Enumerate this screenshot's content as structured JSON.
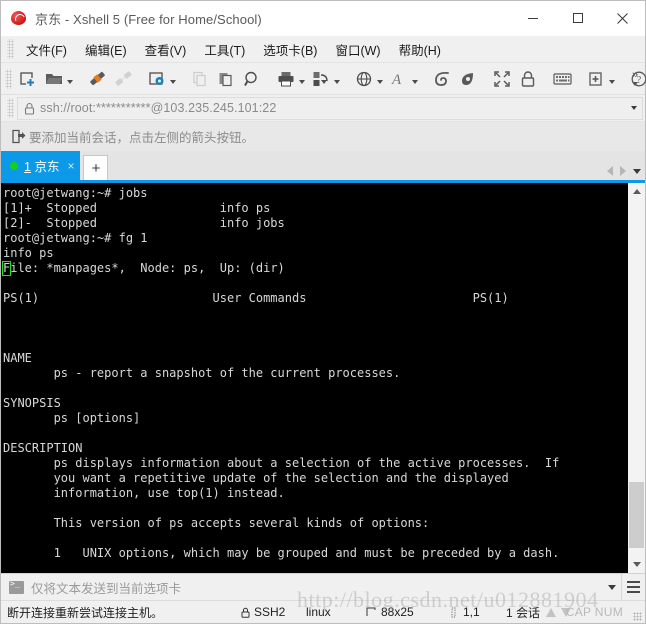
{
  "window": {
    "title": "京东 - Xshell 5 (Free for Home/School)",
    "app_icon": "xshell-logo-icon",
    "minimize_label": "—",
    "maximize_label": "□",
    "close_label": "✕"
  },
  "menubar": {
    "items": [
      {
        "label": "文件(F)",
        "name": "menu-file"
      },
      {
        "label": "编辑(E)",
        "name": "menu-edit"
      },
      {
        "label": "查看(V)",
        "name": "menu-view"
      },
      {
        "label": "工具(T)",
        "name": "menu-tools"
      },
      {
        "label": "选项卡(B)",
        "name": "menu-tabs"
      },
      {
        "label": "窗口(W)",
        "name": "menu-window"
      },
      {
        "label": "帮助(H)",
        "name": "menu-help"
      }
    ]
  },
  "toolbar": {
    "overflow_label": "»",
    "icons": [
      "new-session-icon",
      "open-folder-icon",
      "connect-icon",
      "disconnect-icon",
      "session-properties-icon",
      "copy-icon",
      "paste-icon",
      "find-icon",
      "print-icon",
      "transfer-icon",
      "globe-icon",
      "font-icon",
      "xftp-icon",
      "xagent-icon",
      "fullscreen-icon",
      "lock-icon",
      "keyboard-icon",
      "add-folder-icon",
      "help-icon"
    ]
  },
  "address_bar": {
    "lock_icon": "lock-icon",
    "value": "ssh://root:***********@103.235.245.101:22",
    "placeholder": "ssh://",
    "dropdown_icon": "chevron-down-icon"
  },
  "hint_bar": {
    "icon": "add-to-session-icon",
    "text": "要添加当前会话，点击左侧的箭头按钮。"
  },
  "tabs": {
    "active": {
      "index": "1",
      "title": "京东",
      "status_dot_color": "#15d015",
      "close_label": "×"
    },
    "new_tab_label": "+",
    "nav_prev_icon": "chevron-left-icon",
    "nav_next_icon": "chevron-right-icon",
    "nav_menu_icon": "chevron-down-icon"
  },
  "terminal": {
    "cursor_char": "F",
    "lines_before_cursor": [
      "root@jetwang:~# jobs",
      "[1]+  Stopped                 info ps",
      "[2]-  Stopped                 info jobs",
      "root@jetwang:~# fg 1",
      "info ps"
    ],
    "cursor_line_rest": "ile: *manpages*,  Node: ps,  Up: (dir)",
    "lines_after_cursor": [
      "",
      "PS(1)                        User Commands                       PS(1)",
      "",
      "",
      "",
      "NAME",
      "       ps - report a snapshot of the current processes.",
      "",
      "SYNOPSIS",
      "       ps [options]",
      "",
      "DESCRIPTION",
      "       ps displays information about a selection of the active processes.  If",
      "       you want a repetitive update of the selection and the displayed",
      "       information, use top(1) instead.",
      "",
      "       This version of ps accepts several kinds of options:",
      "",
      "       1   UNIX options, which may be grouped and must be preceded by a dash.",
      ""
    ],
    "scrollbar": {
      "up_icon": "chevron-up-icon",
      "down_icon": "chevron-down-icon"
    }
  },
  "send_bar": {
    "icon": "terminal-prompt-icon",
    "text": "仅将文本发送到当前选项卡",
    "dropdown_icon": "chevron-down-icon",
    "menu_icon": "hamburger-menu-icon"
  },
  "status_bar": {
    "message": "断开连接重新尝试连接主机。",
    "protocol": "SSH2",
    "protocol_icon": "lock-icon",
    "encoding": "linux",
    "size_icon": "terminal-size-icon",
    "size": "88x25",
    "position_icon": "cursor-position-icon",
    "position": "1,1",
    "sessions": "1 会话",
    "upload_icon": "arrow-up-icon",
    "download_icon": "arrow-down-icon",
    "caps": "CAP NUM",
    "resize_grip": "resize-grip-icon"
  },
  "watermark": {
    "text": "http://blog.csdn.net/u012881904"
  },
  "colors": {
    "accent": "#0c9ae8",
    "terminal_bg": "#000000",
    "terminal_fg": "#d8d8d8",
    "cursor": "#19e519",
    "chrome": "#f0f0f0"
  }
}
